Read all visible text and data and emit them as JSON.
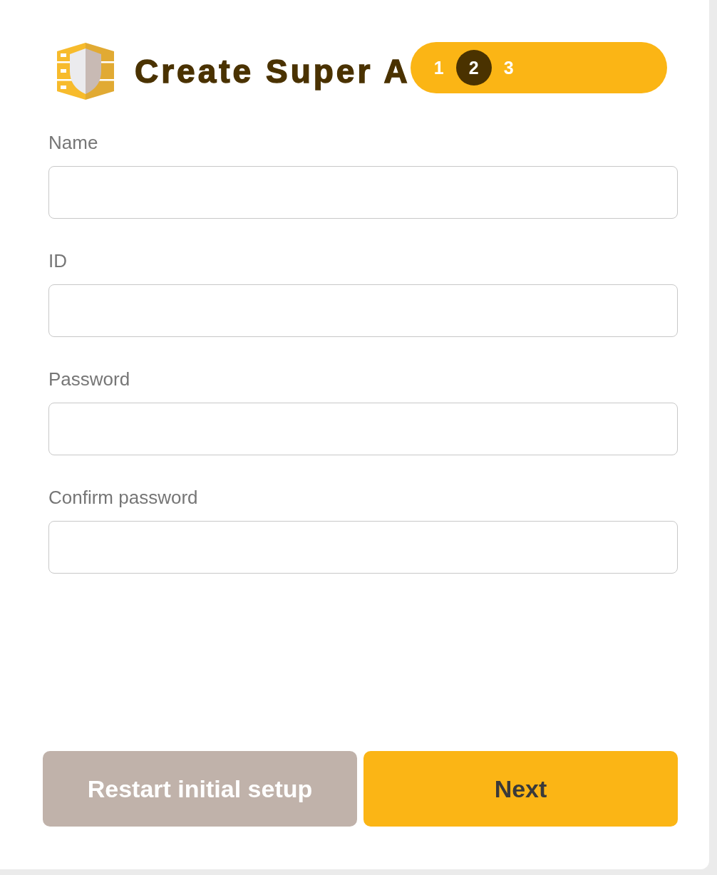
{
  "header": {
    "title": "Create Super A",
    "steps": [
      {
        "label": "1",
        "selected": false
      },
      {
        "label": "2",
        "selected": true
      },
      {
        "label": "3",
        "selected": false
      }
    ]
  },
  "fields": [
    {
      "label": "Name"
    },
    {
      "label": "ID"
    },
    {
      "label": "Password"
    },
    {
      "label": "Confirm password"
    }
  ],
  "buttons": [
    {
      "label": "Restart initial setup",
      "kind": "secondary"
    },
    {
      "label": "Next",
      "kind": "primary"
    }
  ]
}
